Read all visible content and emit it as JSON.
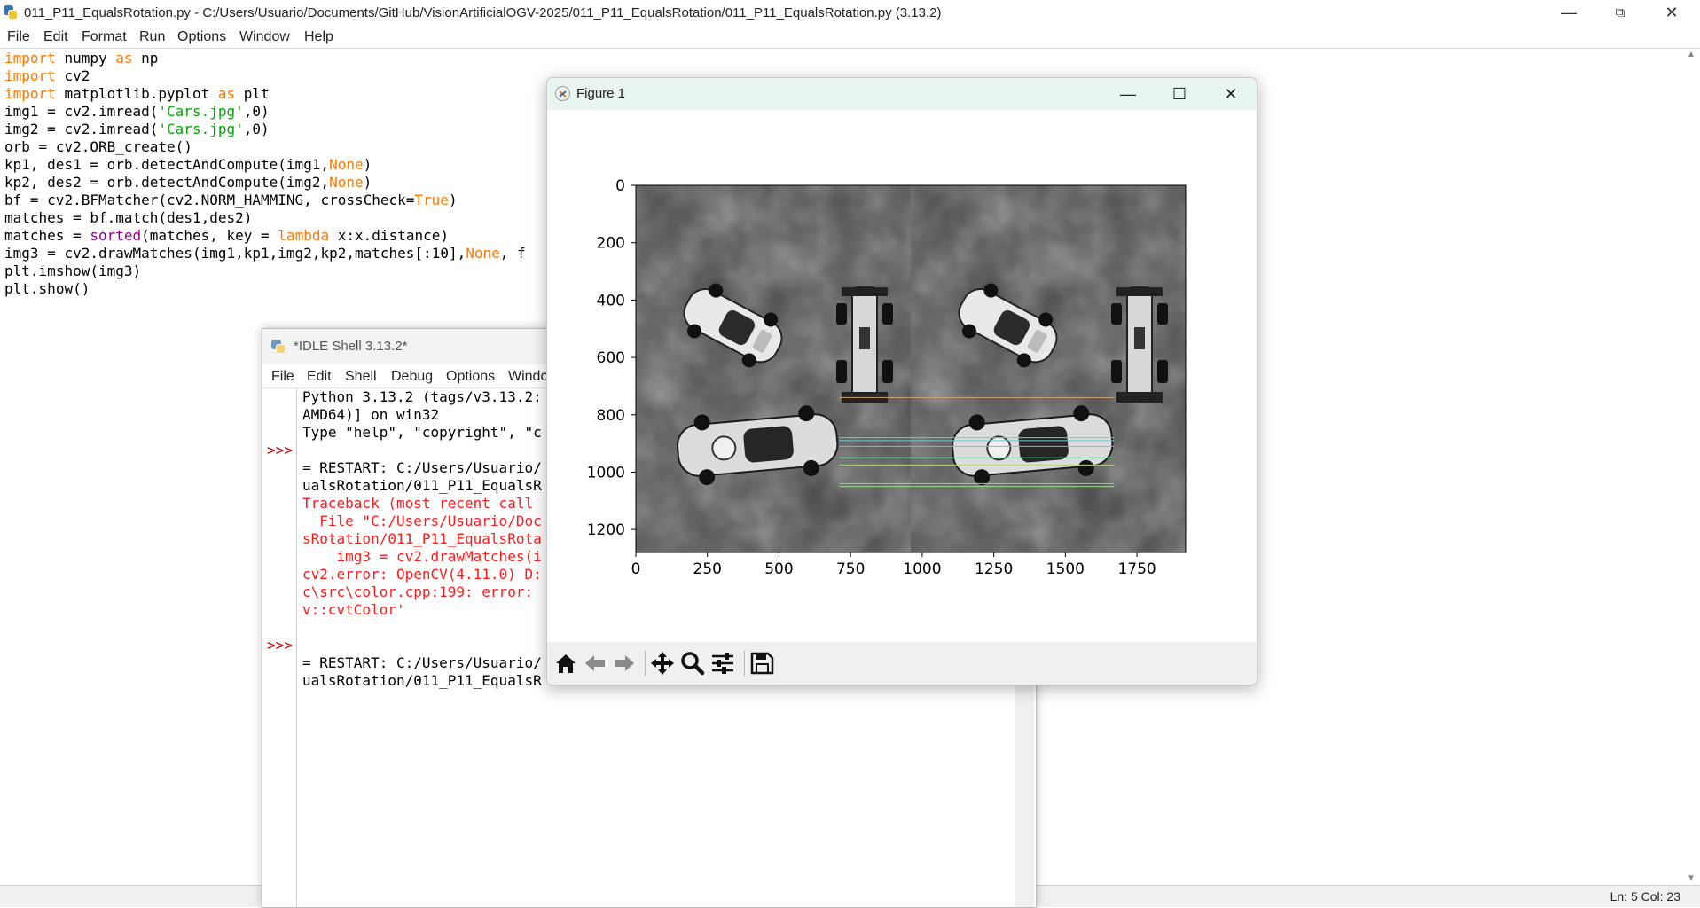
{
  "editor": {
    "title": "011_P11_EqualsRotation.py - C:/Users/Usuario/Documents/GitHub/VisionArtificialOGV-2025/011_P11_EqualsRotation/011_P11_EqualsRotation.py (3.13.2)",
    "controls": {
      "minimize": "—",
      "maximize": "⧉",
      "close": "✕"
    },
    "menu": [
      "File",
      "Edit",
      "Format",
      "Run",
      "Options",
      "Window",
      "Help"
    ],
    "code_lines": [
      "import numpy as np",
      "import cv2",
      "import matplotlib.pyplot as plt",
      "img1 = cv2.imread('Cars.jpg',0)",
      "img2 = cv2.imread('Cars.jpg',0)",
      "orb = cv2.ORB_create()",
      "kp1, des1 = orb.detectAndCompute(img1,None)",
      "kp2, des2 = orb.detectAndCompute(img2,None)",
      "bf = cv2.BFMatcher(cv2.NORM_HAMMING, crossCheck=True)",
      "matches = bf.match(des1,des2)",
      "matches = sorted(matches, key = lambda x:x.distance)",
      "img3 = cv2.drawMatches(img1,kp1,img2,kp2,matches[:10],None, f",
      "plt.imshow(img3)",
      "plt.show()"
    ],
    "status": "Ln: 5   Col: 23"
  },
  "shell": {
    "title": "*IDLE Shell 3.13.2*",
    "menu": [
      "File",
      "Edit",
      "Shell",
      "Debug",
      "Options",
      "Windo"
    ],
    "prompts": [
      ">>>",
      ">>>"
    ],
    "lines": [
      {
        "text": "Python 3.13.2 (tags/v3.13.2:",
        "kind": "normal"
      },
      {
        "text": "AMD64)] on win32",
        "kind": "normal"
      },
      {
        "text": "Type \"help\", \"copyright\", \"c",
        "kind": "normal"
      },
      {
        "text": "",
        "kind": "normal"
      },
      {
        "text": "= RESTART: C:/Users/Usuario/",
        "kind": "normal"
      },
      {
        "text": "ualsRotation/011_P11_EqualsR",
        "kind": "normal"
      },
      {
        "text": "Traceback (most recent call ",
        "kind": "error"
      },
      {
        "text": "  File \"C:/Users/Usuario/Doc",
        "kind": "error"
      },
      {
        "text": "sRotation/011_P11_EqualsRota",
        "kind": "error"
      },
      {
        "text": "    img3 = cv2.drawMatches(i",
        "kind": "error"
      },
      {
        "text": "cv2.error: OpenCV(4.11.0) D:",
        "kind": "error"
      },
      {
        "text": "c\\src\\color.cpp:199: error: ",
        "kind": "error"
      },
      {
        "text": "v::cvtColor'",
        "kind": "error"
      },
      {
        "text": "",
        "kind": "normal"
      },
      {
        "text": "",
        "kind": "normal"
      },
      {
        "text": "= RESTART: C:/Users/Usuario/",
        "kind": "normal"
      },
      {
        "text": "ualsRotation/011_P11_EqualsR",
        "kind": "normal"
      }
    ]
  },
  "figure": {
    "title": "Figure 1",
    "controls": {
      "minimize": "—",
      "maximize": "☐",
      "close": "✕"
    },
    "toolbar_icons": [
      "home-icon",
      "back-arrow-icon",
      "forward-arrow-icon",
      "pan-icon",
      "zoom-icon",
      "configure-subplots-icon",
      "save-icon"
    ]
  },
  "chart_data": {
    "type": "image",
    "description_axes": "imshow of concatenated grayscale images",
    "x_ticks": [
      0,
      250,
      500,
      750,
      1000,
      1250,
      1500,
      1750
    ],
    "y_ticks": [
      0,
      200,
      400,
      600,
      800,
      1000,
      1200
    ],
    "xlim": [
      0,
      1920
    ],
    "ylim": [
      1280,
      0
    ],
    "match_lines": [
      {
        "y1": 740,
        "y2": 740,
        "color": "#d6a56b"
      },
      {
        "y1": 880,
        "y2": 880,
        "color": "#6ad6a8"
      },
      {
        "y1": 890,
        "y2": 890,
        "color": "#6acbd6"
      },
      {
        "y1": 910,
        "y2": 910,
        "color": "#a6a0e8"
      },
      {
        "y1": 950,
        "y2": 950,
        "color": "#7ee29a"
      },
      {
        "y1": 975,
        "y2": 975,
        "color": "#b6d67a"
      },
      {
        "y1": 1040,
        "y2": 1040,
        "color": "#7ad6a0"
      },
      {
        "y1": 1050,
        "y2": 1050,
        "color": "#9cdb8e"
      }
    ],
    "x_split": 960
  }
}
